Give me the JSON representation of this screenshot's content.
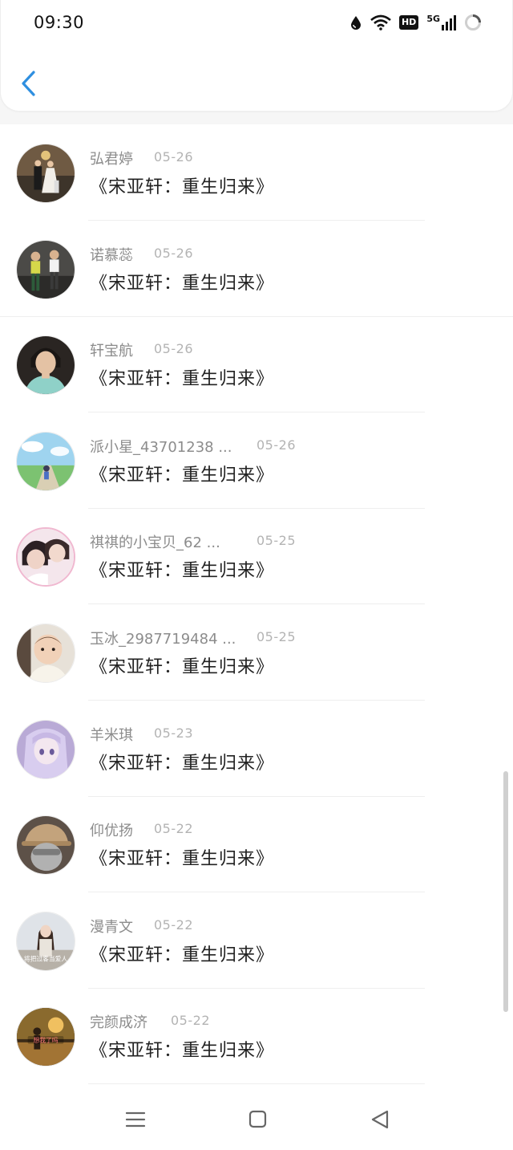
{
  "status_bar": {
    "time": "09:30",
    "icons": [
      "water-drop-icon",
      "wifi-icon",
      "hd-icon",
      "5g-signal-icon",
      "loading-icon"
    ],
    "hd_label": "HD",
    "network_label": "5G"
  },
  "header": {
    "back_icon": "chevron-left-icon",
    "accent": "#2f8fe0"
  },
  "items": [
    {
      "name": "弘君婷",
      "date": "05-26",
      "title": "《宋亚轩：重生归来》",
      "avatar": "avatar-wedding-photo"
    },
    {
      "name": "诺慕蕊",
      "date": "05-26",
      "title": "《宋亚轩：重生归来》",
      "avatar": "avatar-two-children"
    },
    {
      "name": "轩宝航",
      "date": "05-26",
      "title": "《宋亚轩：重生归来》",
      "avatar": "avatar-boy-portrait"
    },
    {
      "name": "派小星_43701238 ...",
      "date": "05-26",
      "title": "《宋亚轩：重生归来》",
      "avatar": "avatar-anime-scenery"
    },
    {
      "name": "祺祺的小宝贝_62 ...",
      "date": "05-25",
      "title": "《宋亚轩：重生归来》",
      "avatar": "avatar-couple-photo"
    },
    {
      "name": "玉冰_2987719484 ...",
      "date": "05-25",
      "title": "《宋亚轩：重生归来》",
      "avatar": "avatar-baby-photo"
    },
    {
      "name": "羊米琪",
      "date": "05-23",
      "title": "《宋亚轩：重生归来》",
      "avatar": "avatar-anime-girl"
    },
    {
      "name": "仰优扬",
      "date": "05-22",
      "title": "《宋亚轩：重生归来》",
      "avatar": "avatar-cap-person"
    },
    {
      "name": "漫青文",
      "date": "05-22",
      "title": "《宋亚轩：重生归来》",
      "avatar": "avatar-girl-street"
    },
    {
      "name": "完颜成济",
      "date": "05-22",
      "title": "《宋亚轩：重生归来》",
      "avatar": "avatar-sunset-child"
    }
  ],
  "avatar_overlay_texts": {
    "avatar-girl-street": "将把过客当爱人",
    "avatar-sunset-child": "想我了吗"
  },
  "navbar": {
    "icons": [
      "menu-icon",
      "home-square-icon",
      "back-triangle-icon"
    ]
  }
}
